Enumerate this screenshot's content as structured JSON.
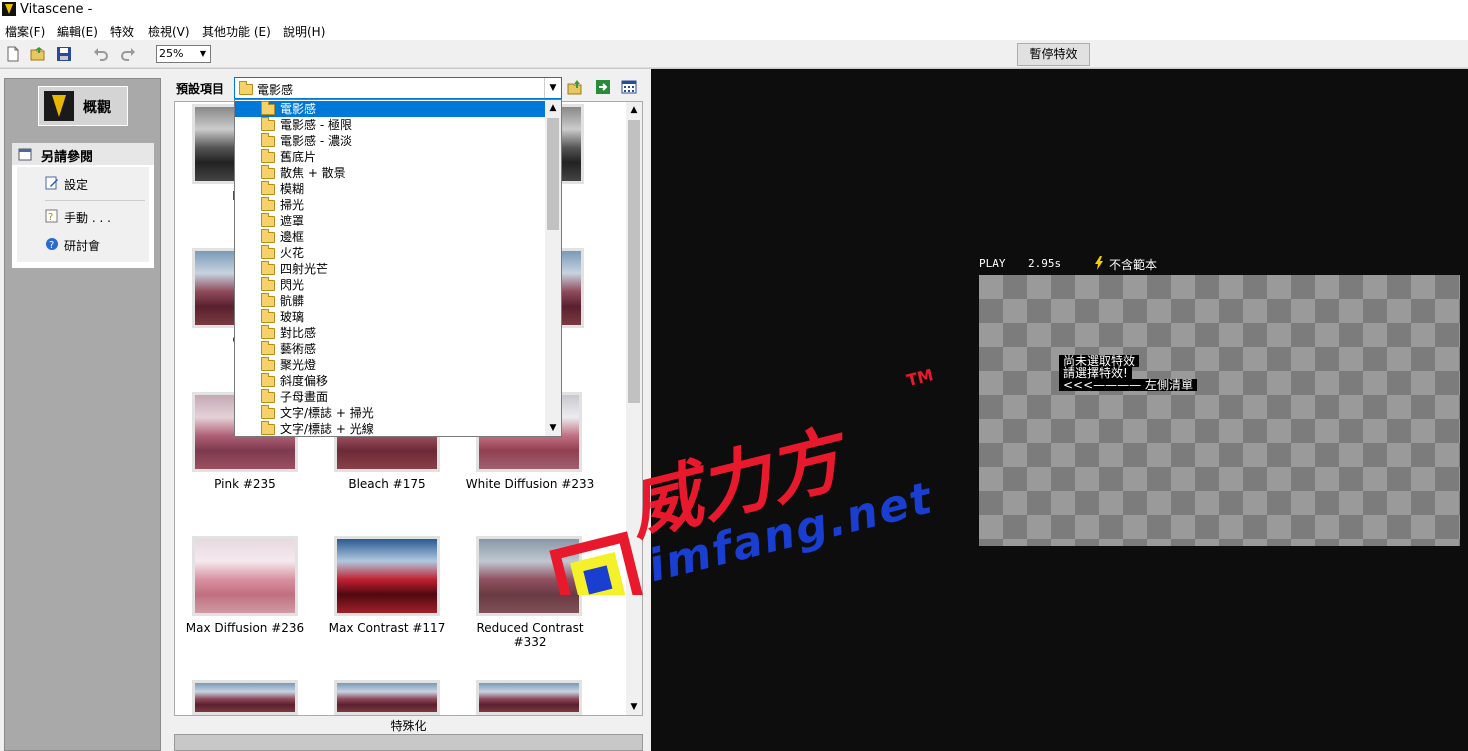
{
  "window": {
    "title": "Vitascene -"
  },
  "menu": [
    "檔案(F)",
    "編輯(E)",
    "特效",
    "檢視(V)",
    "其他功能 (E)",
    "說明(H)"
  ],
  "toolbar": {
    "zoom": "25%",
    "pause_label": "暫停特效"
  },
  "left": {
    "overview_label": "概觀",
    "see_also_title": "另請參閱",
    "items": [
      "設定",
      "手動 . . .",
      "研討會"
    ]
  },
  "preset": {
    "label": "預設項目",
    "selected": "電影感"
  },
  "dropdown_items": [
    "電影感",
    "電影感 - 極限",
    "電影感 - 濃淡",
    "舊底片",
    "散焦 + 散景",
    "模糊",
    "掃光",
    "遮罩",
    "邊框",
    "火花",
    "四射光芒",
    "閃光",
    "骯髒",
    "玻璃",
    "對比感",
    "藝術感",
    "聚光燈",
    "斜度偏移",
    "子母畫面",
    "文字/標誌 + 掃光",
    "文字/標誌 + 光線"
  ],
  "gallery": {
    "row1": [
      "Ingr",
      "",
      ""
    ],
    "row2": [
      "Coo",
      "",
      ""
    ],
    "row3": [
      "Pink #235",
      "Bleach #175",
      "White Diffusion #233"
    ],
    "row4": [
      "Max Diffusion #236",
      "Max Contrast #117",
      "Reduced Contrast #332"
    ],
    "footer": "特殊化"
  },
  "preview": {
    "play": "PLAY",
    "time": "2.95s",
    "template_status": "不含範本",
    "messages": [
      "尚未選取特效",
      "請選擇特效!",
      "<<<———— 左側清單"
    ]
  },
  "watermark": {
    "cn": "威力方",
    "tm": "TM",
    "url": "imfang.net"
  },
  "colors": {
    "accent": "#0078d7",
    "preview_bg": "#0d0d0d",
    "watermark_red": "#e8192c",
    "watermark_blue": "#1a3fd0"
  }
}
